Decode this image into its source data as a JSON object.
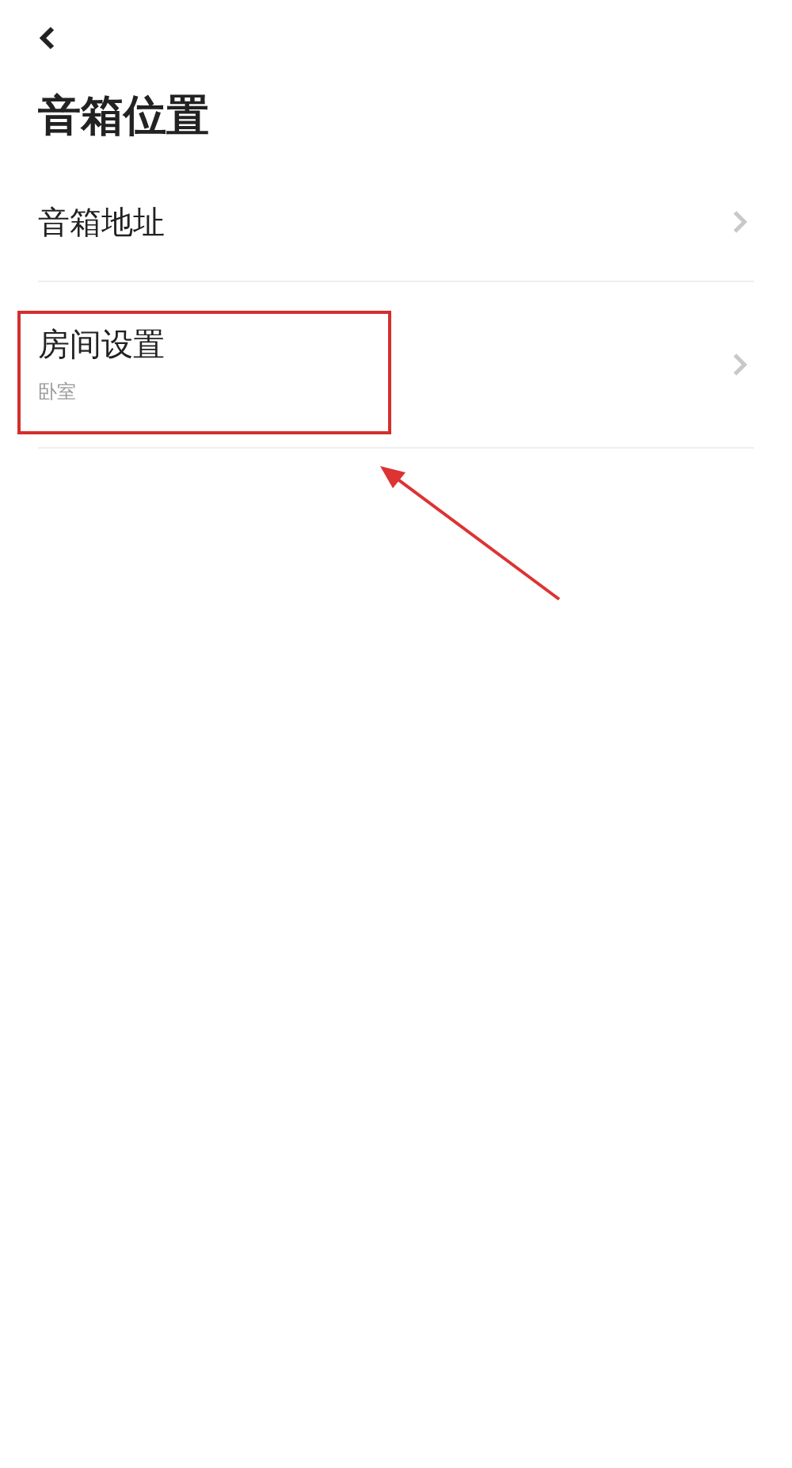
{
  "title": "音箱位置",
  "items": [
    {
      "label": "音箱地址",
      "highlighted": false
    },
    {
      "label": "房间设置",
      "value": "卧室",
      "highlighted": true
    }
  ]
}
